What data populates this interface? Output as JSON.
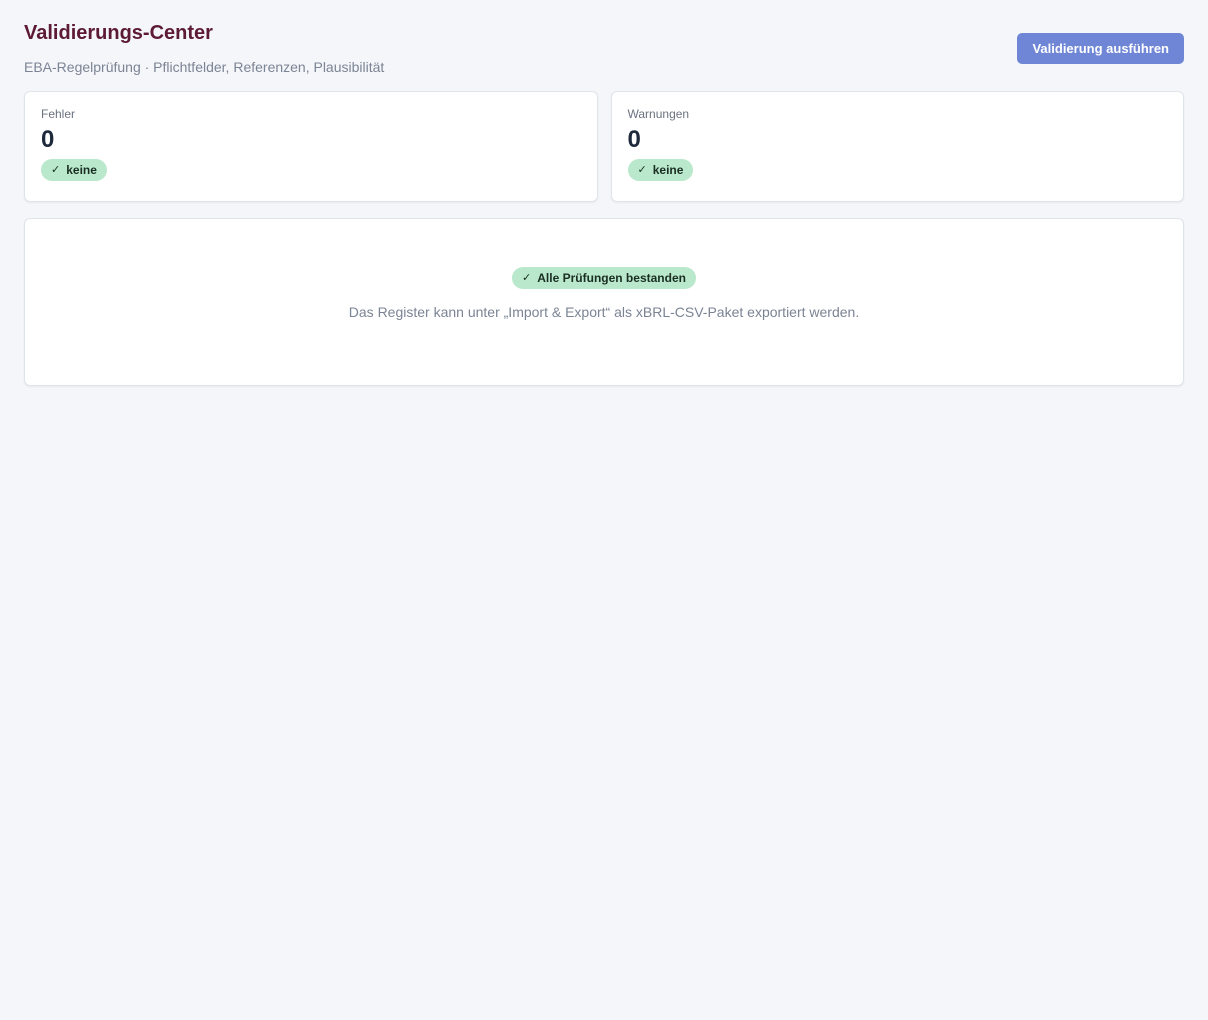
{
  "header": {
    "title": "Validierungs-Center",
    "subtitle": "EBA-Regelprüfung · Pflichtfelder, Referenzen, Plausibilität",
    "run_button_label": "Validierung ausführen"
  },
  "stats": [
    {
      "label": "Fehler",
      "value": "0",
      "badge": "keine",
      "badge_icon": "check-icon"
    },
    {
      "label": "Warnungen",
      "value": "0",
      "badge": "keine",
      "badge_icon": "check-icon"
    }
  ],
  "result": {
    "badge": "Alle Prüfungen bestanden",
    "badge_icon": "check-icon",
    "message": "Das Register kann unter „Import & Export“ als xBRL-CSV-Paket exportiert werden."
  },
  "colors": {
    "title": "#5c1a33",
    "primary_button": "#6f86d6",
    "success_badge": "#b9e8cc",
    "background": "#f5f6fa"
  }
}
